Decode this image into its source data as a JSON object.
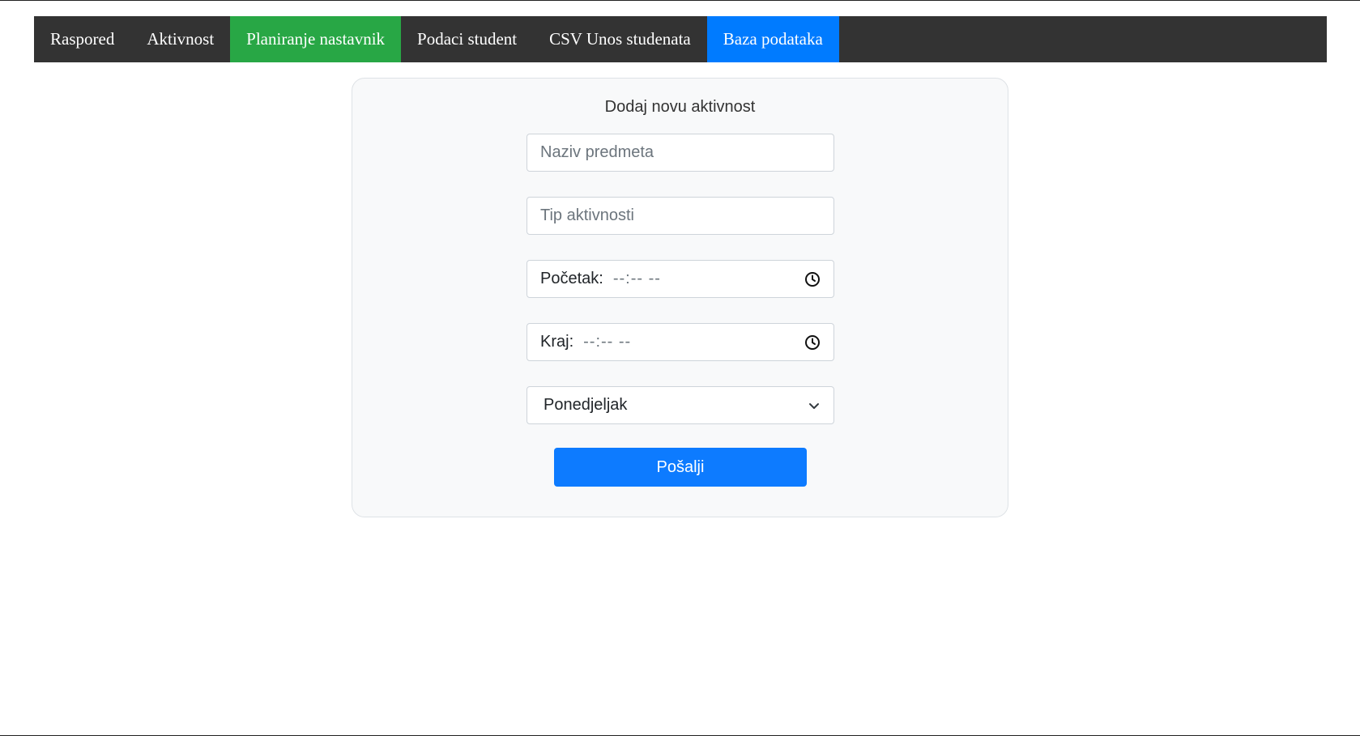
{
  "nav": {
    "items": [
      {
        "label": "Raspored"
      },
      {
        "label": "Aktivnost"
      },
      {
        "label": "Planiranje nastavnik"
      },
      {
        "label": "Podaci student"
      },
      {
        "label": "CSV Unos studenata"
      },
      {
        "label": "Baza podataka"
      }
    ]
  },
  "form": {
    "title": "Dodaj novu aktivnost",
    "subject_placeholder": "Naziv predmeta",
    "type_placeholder": "Tip aktivnosti",
    "start": {
      "label": "Početak:",
      "value": "--:-- --"
    },
    "end": {
      "label": "Kraj:",
      "value": "--:-- --"
    },
    "day_select": {
      "selected": "Ponedjeljak"
    },
    "submit_label": "Pošalji"
  },
  "colors": {
    "navbar_bg": "#333333",
    "active_green": "#28a745",
    "active_blue": "#007bff",
    "submit_bg": "#0d7bff",
    "card_bg": "#f8f9fa"
  },
  "icons": {
    "time": "clock-icon",
    "select": "chevron-down-icon"
  }
}
